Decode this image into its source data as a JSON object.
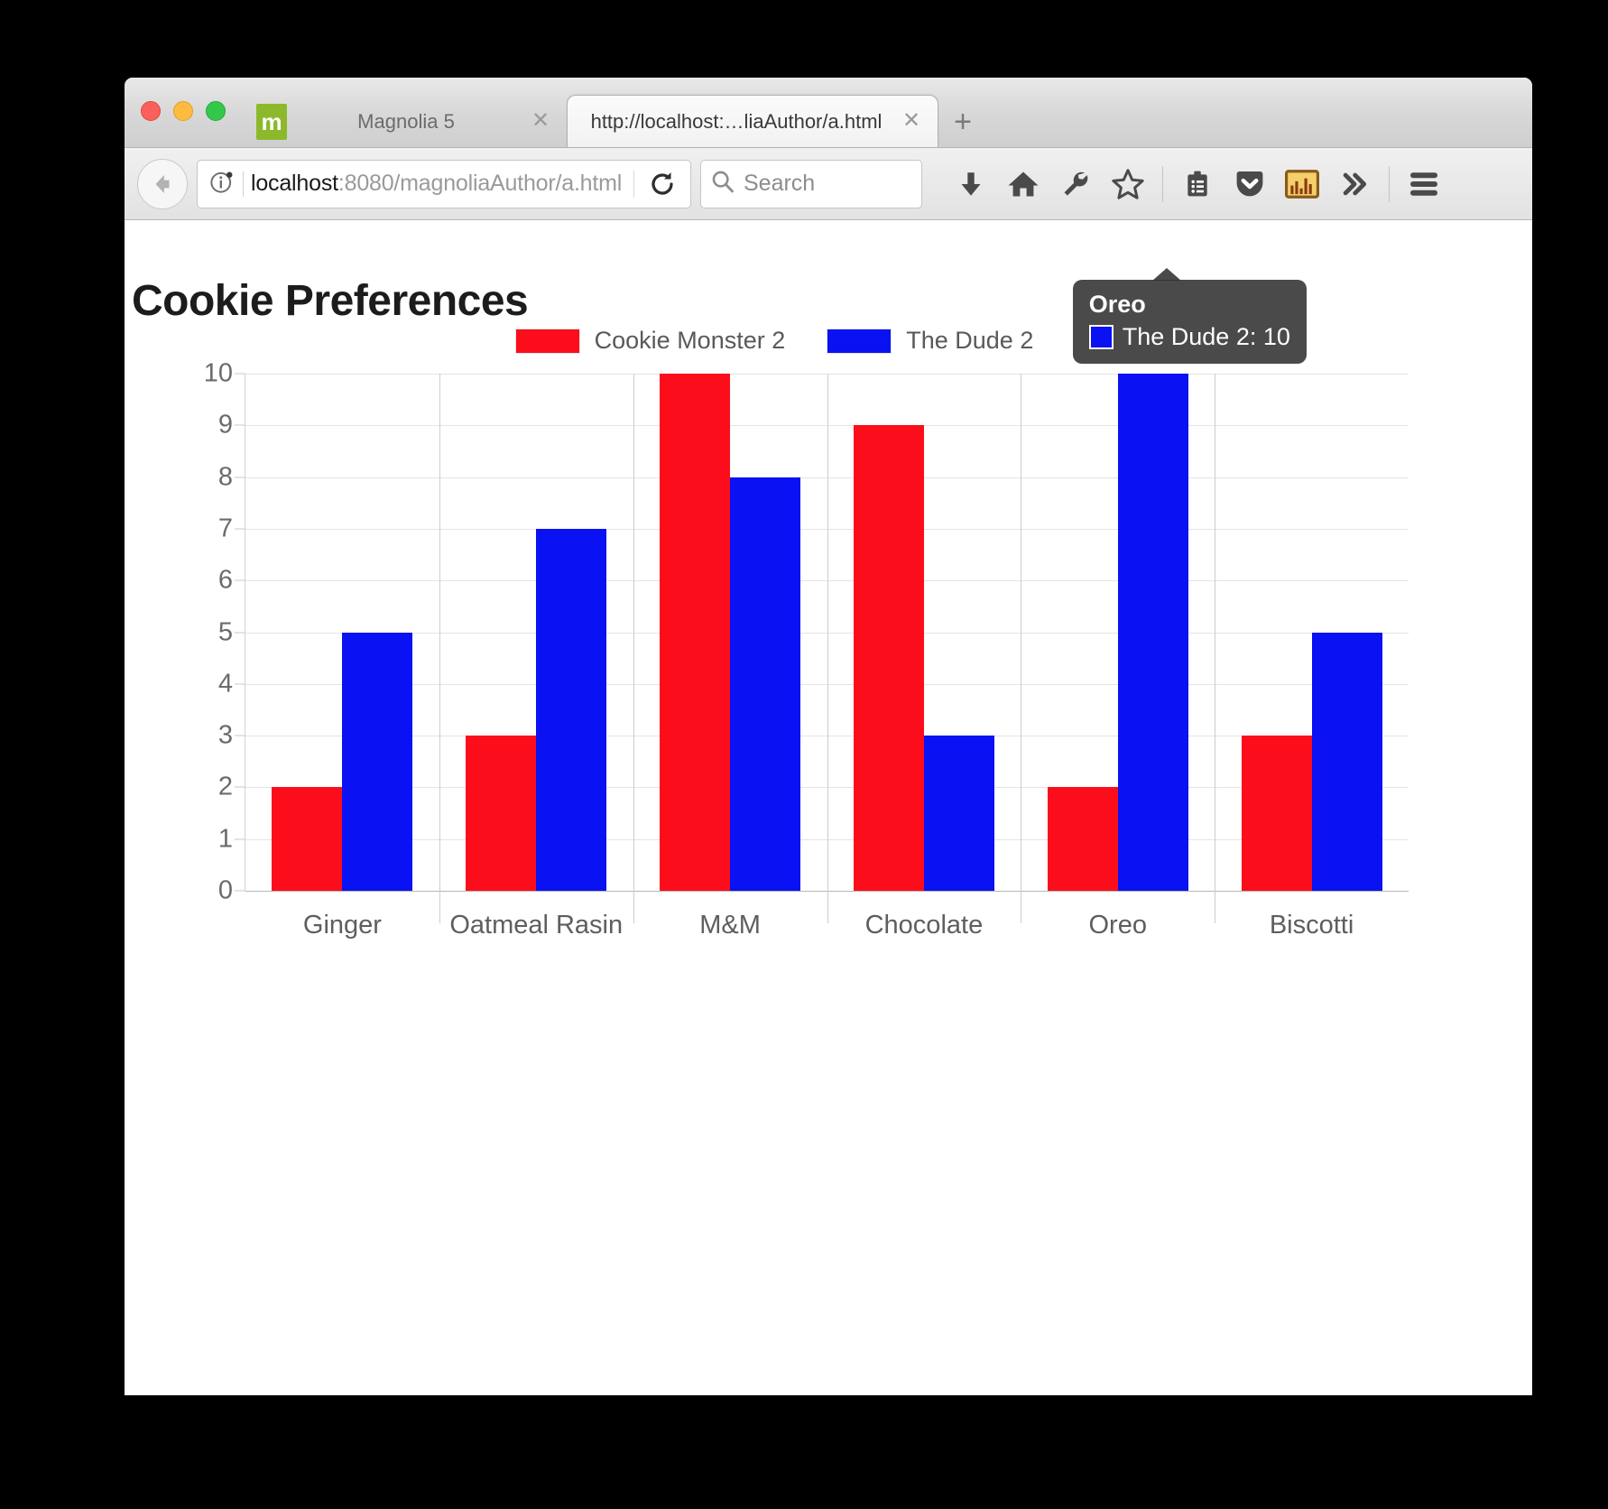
{
  "window": {
    "traffic_lights": [
      "close",
      "minimize",
      "zoom"
    ],
    "tabs": [
      {
        "favicon_letter": "m",
        "title": "Magnolia 5",
        "active": false,
        "close_glyph": "✕"
      },
      {
        "favicon_letter": "",
        "title": "http://localhost:…liaAuthor/a.html",
        "active": true,
        "close_glyph": "✕"
      }
    ],
    "new_tab_glyph": "+"
  },
  "navbar": {
    "back_label": "Back",
    "url_host": "localhost",
    "url_rest": ":8080/magnoliaAuthor/a.html",
    "search_placeholder": "Search",
    "toolbar_buttons": [
      {
        "name": "downloads-icon",
        "label": "Downloads"
      },
      {
        "name": "home-icon",
        "label": "Home"
      },
      {
        "name": "wrench-icon",
        "label": "Developer Tools"
      },
      {
        "name": "star-icon",
        "label": "Bookmark"
      },
      {
        "name": "reading-list-icon",
        "label": "Reader List"
      },
      {
        "name": "pocket-icon",
        "label": "Pocket"
      },
      {
        "name": "chart-icon",
        "label": "Charts"
      },
      {
        "name": "overflow-icon",
        "label": "»"
      },
      {
        "name": "hamburger-menu-icon",
        "label": "Menu"
      }
    ]
  },
  "page": {
    "heading": "Cookie Preferences"
  },
  "tooltip": {
    "title": "Oreo",
    "series_label": "The Dude 2",
    "value": "10",
    "text": "The Dude 2: 10",
    "swatch_color": "#0a11f2"
  },
  "chart_data": {
    "type": "bar",
    "title": "Cookie Preferences",
    "xlabel": "",
    "ylabel": "",
    "ylim": [
      0,
      10
    ],
    "ytick_step": 1,
    "yticks": [
      "0",
      "1",
      "2",
      "3",
      "4",
      "5",
      "6",
      "7",
      "8",
      "9",
      "10"
    ],
    "grid": true,
    "legend_position": "top-center",
    "categories": [
      "Ginger",
      "Oatmeal Rasin",
      "M&M",
      "Chocolate",
      "Oreo",
      "Biscotti"
    ],
    "series": [
      {
        "name": "Cookie Monster 2",
        "color": "#fc0d1b",
        "values": [
          2,
          3,
          10,
          9,
          2,
          3
        ]
      },
      {
        "name": "The Dude 2",
        "color": "#0a11f2",
        "values": [
          5,
          7,
          8,
          3,
          10,
          5
        ]
      }
    ]
  }
}
